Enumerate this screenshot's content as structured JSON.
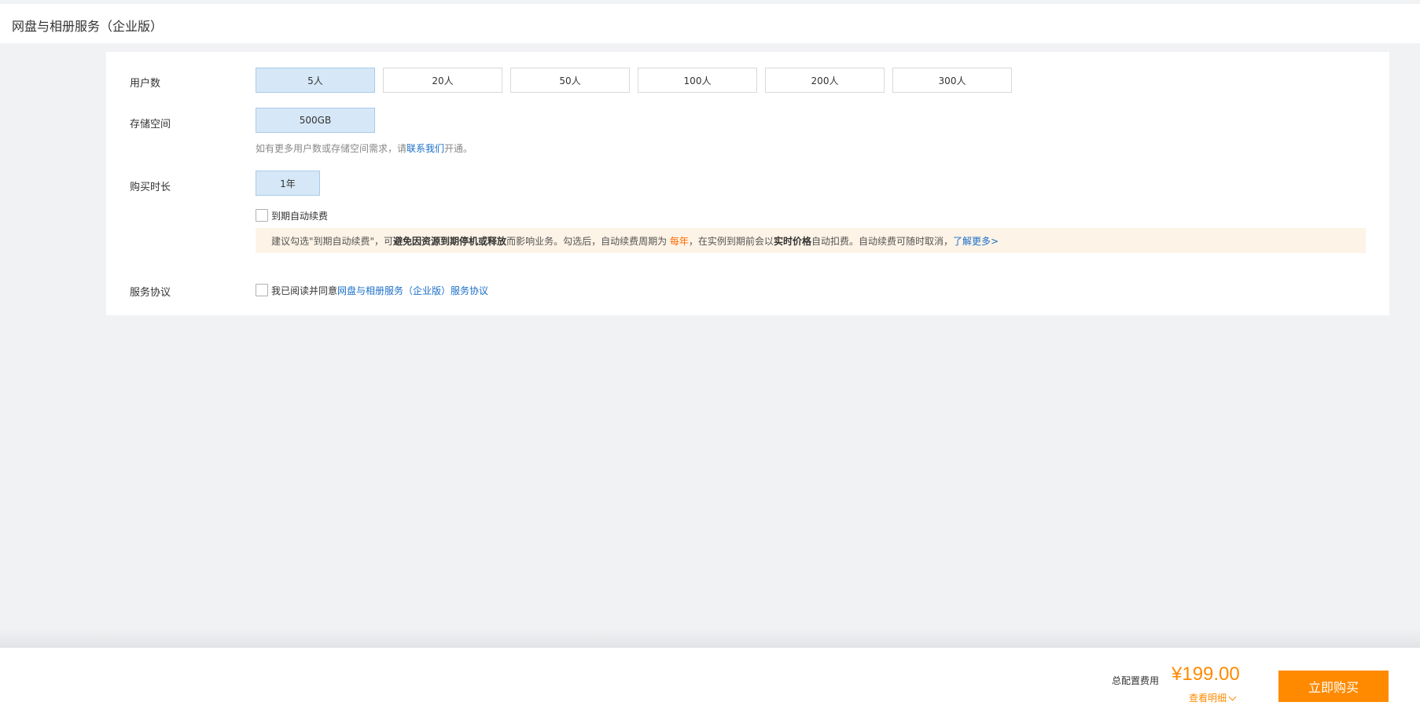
{
  "header": {
    "title": "网盘与相册服务（企业版）"
  },
  "users": {
    "label": "用户数",
    "options": [
      "5人",
      "20人",
      "50人",
      "100人",
      "200人",
      "300人"
    ],
    "selected": "5人"
  },
  "storage": {
    "label": "存储空间",
    "options": [
      "500GB"
    ],
    "hint_prefix": "如有更多用户数或存储空间需求，请",
    "hint_link": "联系我们",
    "hint_suffix": "开通。"
  },
  "duration": {
    "label": "购买时长",
    "options": [
      "1年"
    ],
    "auto_renew_label": "到期自动续费"
  },
  "tip": {
    "part1": "建议勾选\"到期自动续费\"，可",
    "bold1": "避免因资源到期停机或释放",
    "part2": "而影响业务。勾选后，自动续费周期为",
    "orange": "每年",
    "part3": "，在实例到期前会以",
    "bold2": "实时价格",
    "part4": "自动扣费。自动续费可随时取消，",
    "link": "了解更多>"
  },
  "agreement": {
    "label": "服务协议",
    "prefix": "我已阅读并同意",
    "link": "网盘与相册服务（企业版）服务协议"
  },
  "footer": {
    "total_label": "总配置费用",
    "price": "¥199.00",
    "detail": "查看明细",
    "buy": "立即购买"
  },
  "colors": {
    "accent_orange": "#ff8a00",
    "link_blue": "#1a6fc8",
    "selected_bg": "#d6e8f7"
  }
}
